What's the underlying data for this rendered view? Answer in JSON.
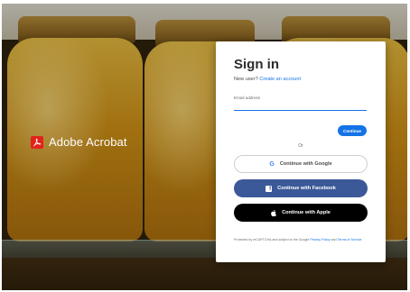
{
  "brand": {
    "name": "Adobe Acrobat",
    "logo_icon": "adobe-acrobat-logo-icon"
  },
  "signin": {
    "title": "Sign in",
    "new_user_text": "New user?",
    "create_account_link": "Create an account",
    "email_label": "Email address",
    "email_value": "",
    "continue_label": "Continue",
    "or_text": "Or",
    "google_label": "Continue with Google",
    "facebook_label": "Continue with Facebook",
    "apple_label": "Continue with Apple",
    "legal_prefix": "Protected by reCAPTCHA and subject to the Google",
    "privacy_link": "Privacy Policy",
    "legal_and": "and",
    "terms_link": "Terms of Service",
    "legal_suffix": "."
  },
  "colors": {
    "accent_blue": "#1473e6",
    "facebook_blue": "#3b5998",
    "apple_black": "#000000",
    "adobe_red": "#e2231a"
  }
}
